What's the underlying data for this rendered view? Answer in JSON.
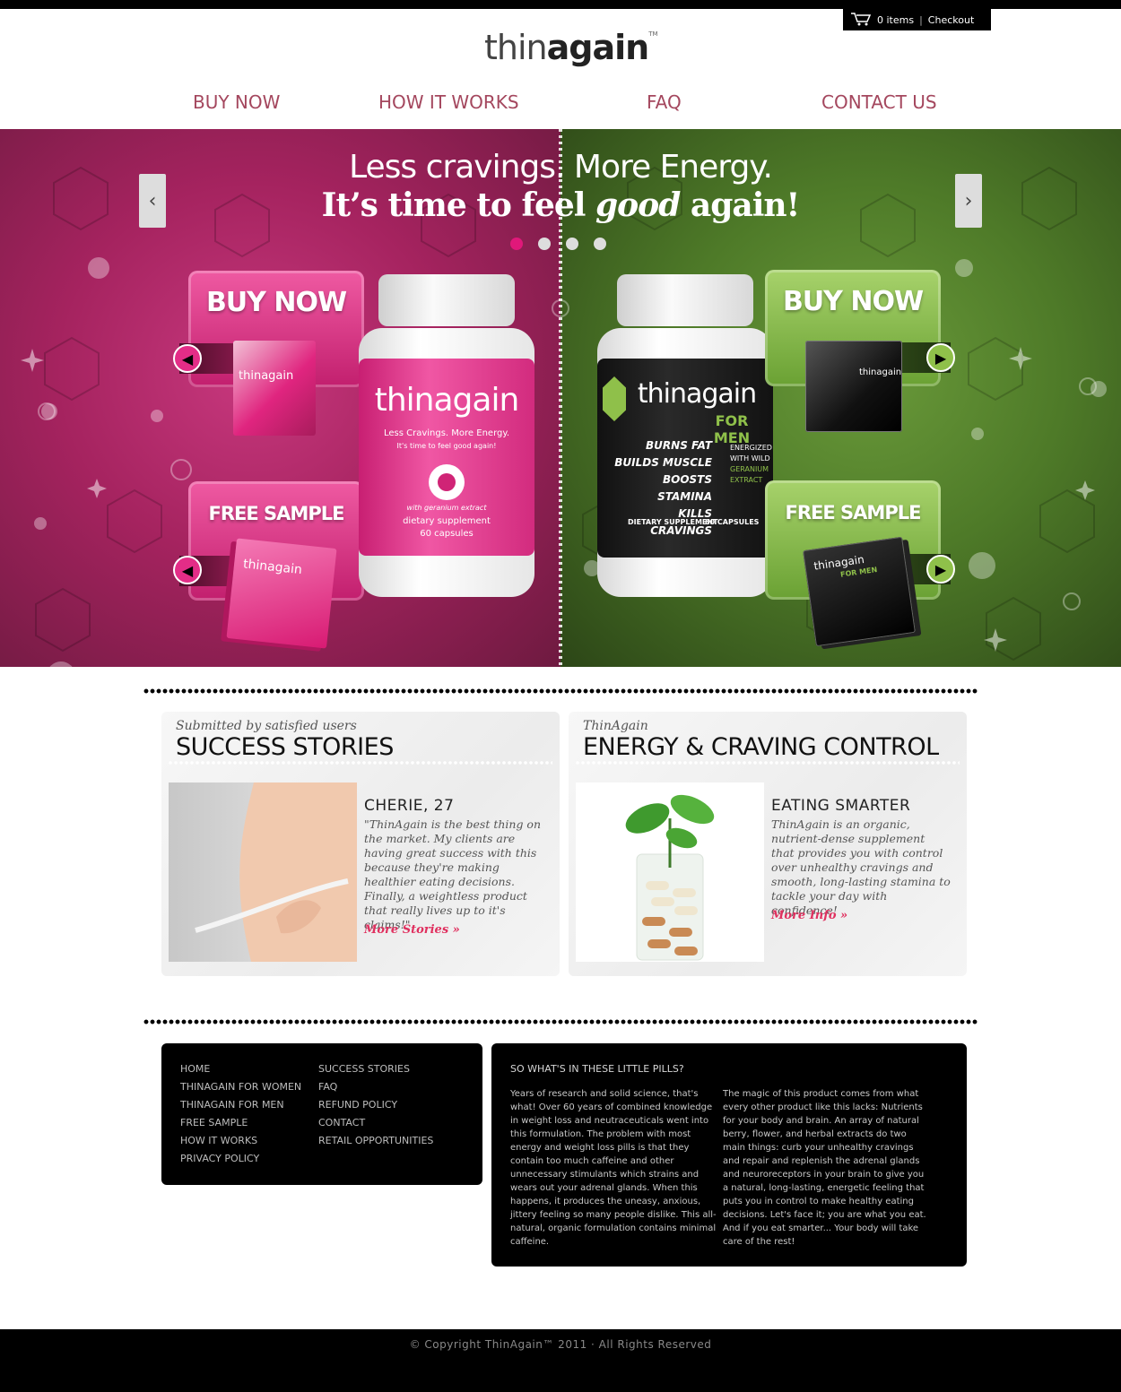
{
  "header": {
    "cart_items": "0 items",
    "cart_separator": "|",
    "checkout_label": "Checkout",
    "logo_thin": "thin",
    "logo_again": "again",
    "logo_tm": "TM"
  },
  "nav": {
    "items": [
      {
        "label": "BUY NOW"
      },
      {
        "label": "HOW IT WORKS"
      },
      {
        "label": "FAQ"
      },
      {
        "label": "CONTACT US"
      }
    ]
  },
  "hero": {
    "line1": "Less cravings.  More Energy.",
    "line2_start": "It’s time to feel ",
    "line2_em": "good",
    "line2_end": " again!",
    "prev_icon": "chevron-left-icon",
    "next_icon": "chevron-right-icon",
    "slides": 4,
    "active_slide": 1,
    "women": {
      "buy_label": "BUY NOW",
      "sample_label": "FREE SAMPLE",
      "box_brand": "thinagain",
      "bottle_brand": "thinagain",
      "bottle_tagline": "Less Cravings.  More Energy.",
      "bottle_sub": "It's time to feel good again!",
      "bottle_extract": "with geranium extract",
      "bottle_type": "dietary supplement",
      "bottle_count": "60 capsules",
      "accent": "#e0187a"
    },
    "men": {
      "buy_label": "BUY NOW",
      "sample_label": "FREE SAMPLE",
      "box_brand": "thinagain",
      "bottle_brand": "thinagain",
      "bottle_for": "FOR MEN",
      "bottle_claims": [
        "BURNS FAT",
        "BUILDS MUSCLE",
        "BOOSTS STAMINA",
        "KILLS CRAVINGS"
      ],
      "bottle_energized": [
        "ENERGIZED",
        "WITH WILD",
        "GERANIUM",
        "EXTRACT"
      ],
      "bottle_type": "DIETARY SUPPLEMENT",
      "bottle_count": "60 CAPSULES",
      "sample_for": "FOR MEN",
      "accent": "#8fc04a"
    }
  },
  "success": {
    "subtitle": "Submitted by satisfied users",
    "title": "SUCCESS STORIES",
    "name": "CHERIE, 27",
    "quote": "\"ThinAgain is the best thing on the market. My clients are having great success with this because they're making healthier eating decisions. Finally, a weightless product that really lives up to it's claims!\"",
    "more": "More Stories »"
  },
  "energy": {
    "subtitle": "ThinAgain",
    "title": "ENERGY & CRAVING CONTROL",
    "heading": "EATING SMARTER",
    "body": "ThinAgain is an organic, nutrient-dense supplement that provides you with control over unhealthy cravings and smooth, long-lasting stamina to tackle your day with confidence!",
    "more": "More Info »"
  },
  "footer": {
    "col1": [
      "HOME",
      "THINAGAIN FOR WOMEN",
      "THINAGAIN FOR MEN",
      "FREE SAMPLE",
      "HOW IT WORKS",
      "PRIVACY POLICY"
    ],
    "col2": [
      "SUCCESS STORIES",
      "FAQ",
      "REFUND POLICY",
      "CONTACT",
      "RETAIL OPPORTUNITIES"
    ],
    "info_title": "SO WHAT'S IN THESE LITTLE PILLS?",
    "info_p1": "Years of research and solid science, that's what! Over 60 years of combined knowledge in weight loss and neutraceuticals went into this formulation. The problem with most energy and weight loss pills is that they contain too much caffeine and other unnecessary stimulants which strains and wears out your adrenal glands. When this happens, it produces the uneasy, anxious, jittery feeling so many people dislike. This all-natural, organic formulation contains minimal caffeine.",
    "info_p2": "The magic of this product comes from what every other product like this lacks: Nutrients for your body and brain. An array of natural berry, flower, and herbal extracts do two main things: curb your unhealthy cravings and repair and replenish the adrenal glands and neuroreceptors in your brain to give you a natural, long-lasting, energetic feeling that puts you in control to make healthy eating decisions. Let's face it; you are what you eat. And if you eat smarter... Your body will take care of the rest!",
    "copyright": "© Copyright ThinAgain™ 2011   ·   All Rights Reserved"
  }
}
